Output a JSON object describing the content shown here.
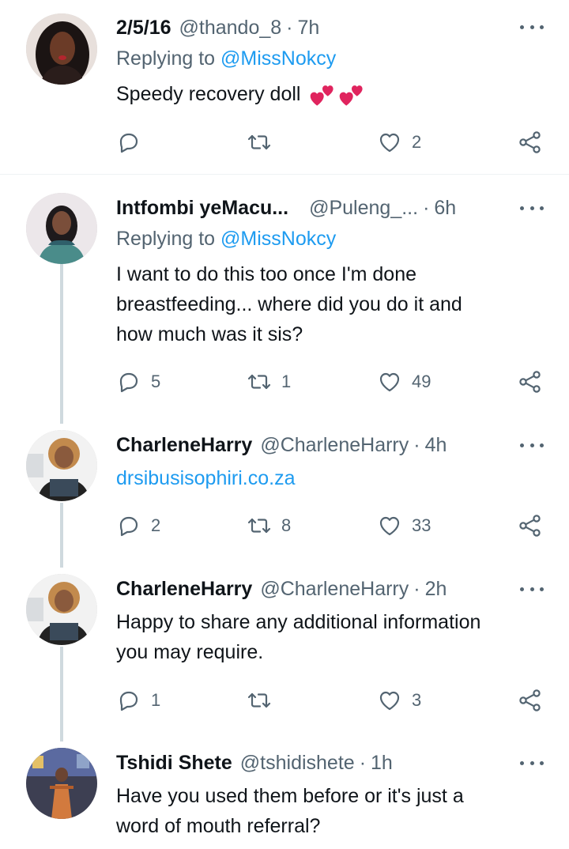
{
  "tweets": [
    {
      "name": "2/5/16",
      "handle": "@thando_8",
      "time": "7h",
      "replying_label": "Replying to",
      "replying_to": "@MissNokcy",
      "text": "Speedy recovery doll",
      "emojis": "💕💕",
      "replies": "",
      "retweets": "",
      "likes": "2"
    },
    {
      "name": "Intfombi yeMacu...",
      "handle": "@Puleng_...",
      "time": "6h",
      "replying_label": "Replying to",
      "replying_to": "@MissNokcy",
      "text_lines": [
        "I want to do this too once I'm done",
        "breastfeeding... where did you do it and",
        "how much was it sis?"
      ],
      "replies": "5",
      "retweets": "1",
      "likes": "49"
    },
    {
      "name": "CharleneHarry",
      "handle": "@CharleneHarry",
      "time": "4h",
      "link": "drsibusisophiri.co.za",
      "replies": "2",
      "retweets": "8",
      "likes": "33"
    },
    {
      "name": "CharleneHarry",
      "handle": "@CharleneHarry",
      "time": "2h",
      "text_lines": [
        "Happy to share any additional information",
        "you may require."
      ],
      "replies": "1",
      "retweets": "",
      "likes": "3"
    },
    {
      "name": "Tshidi Shete",
      "handle": "@tshidishete",
      "time": "1h",
      "text_lines": [
        "Have you used them before or it's just a",
        "word of mouth referral?"
      ]
    }
  ],
  "separator": "·",
  "colors": {
    "accent": "#1d9bf0",
    "secondary_text": "#536471",
    "thread_line": "#cfd9de"
  },
  "icons": [
    "reply-icon",
    "retweet-icon",
    "like-icon",
    "share-icon",
    "more-icon"
  ]
}
